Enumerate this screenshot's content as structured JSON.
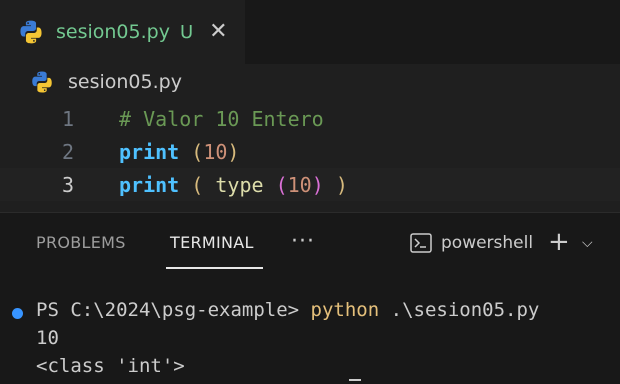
{
  "tab": {
    "filename": "sesion05.py",
    "status": "U",
    "close": "✕"
  },
  "breadcrumb": {
    "filename": "sesion05.py"
  },
  "editor": {
    "lines": [
      {
        "number": "1",
        "comment": "# Valor 10 Entero"
      },
      {
        "number": "2",
        "kw": "print",
        "space": " ",
        "open": "(",
        "num": "10",
        "close": ")"
      },
      {
        "number": "3",
        "kw": "print",
        "sp1": " ",
        "open": "(",
        "sp2": " ",
        "fn": "type",
        "sp3": " ",
        "open2": "(",
        "num": "10",
        "close2": ")",
        "sp4": " ",
        "close": ")"
      }
    ]
  },
  "panel": {
    "tabs": [
      "PROBLEMS",
      "TERMINAL"
    ],
    "more": "···",
    "shell": "powershell",
    "plus": "+",
    "chevron": "⌵"
  },
  "terminal": {
    "prompt": "PS C:\\2024\\psg-example> ",
    "command": "python",
    "args": " .\\sesion05.py",
    "output": [
      "10",
      "<class 'int'>"
    ]
  },
  "colors": {
    "accent_modified": "#73c991",
    "keyword": "#4fc1ff",
    "comment": "#6a9955"
  },
  "icons": [
    "python-icon",
    "close-icon",
    "more-icon",
    "terminal-icon",
    "plus-icon",
    "chevron-down-icon"
  ]
}
